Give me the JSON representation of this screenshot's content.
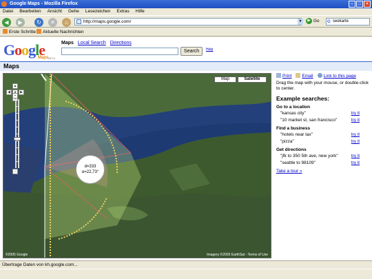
{
  "window": {
    "title": "Google Maps - Mozilla Firefox"
  },
  "menu": [
    "Datei",
    "Bearbeiten",
    "Ansicht",
    "Gehe",
    "Lesezeichen",
    "Extras",
    "Hilfe"
  ],
  "toolbar": {
    "url": "http://maps.google.com/",
    "go_label": "Go",
    "search_value": "seekarte"
  },
  "bookmarks": [
    "Erste Schritte",
    "Aktuelle Nachrichten"
  ],
  "google": {
    "logo_letters": [
      "G",
      "o",
      "o",
      "g",
      "l",
      "e"
    ],
    "logo_sub": "Maps",
    "logo_beta": "BETA",
    "nav_current": "Maps",
    "nav_links": [
      "Local Search",
      "Directions"
    ],
    "search_button": "Search",
    "help": "Help"
  },
  "maps_header": "Maps",
  "map": {
    "type_buttons": [
      "Map",
      "Satellite"
    ],
    "selected_type": "Satellite",
    "copyright_left": "©2005 Google",
    "copyright_right": "Imagery ©2005 EarthSat - Terms of Use",
    "readout_d": "d=333",
    "readout_a": "α=22,73°"
  },
  "sidebar": {
    "actions": [
      "Print",
      "Email",
      "Link to this page"
    ],
    "hint": "Drag the map with your mouse, or double-click to center.",
    "example_heading": "Example searches:",
    "try_label": "try it",
    "sections": [
      {
        "title": "Go to a location",
        "items": [
          "\"kansas city\"",
          "\"10 market st, san francisco\""
        ]
      },
      {
        "title": "Find a business",
        "items": [
          "\"hotels near lax\"",
          "\"pizza\""
        ]
      },
      {
        "title": "Get directions",
        "items": [
          "\"jfk to 350 5th ave, new york\"",
          "\"seattle to 98109\""
        ]
      }
    ],
    "tour": "Take a tour »"
  },
  "status": "Übertrage Daten von kh.google.com..."
}
